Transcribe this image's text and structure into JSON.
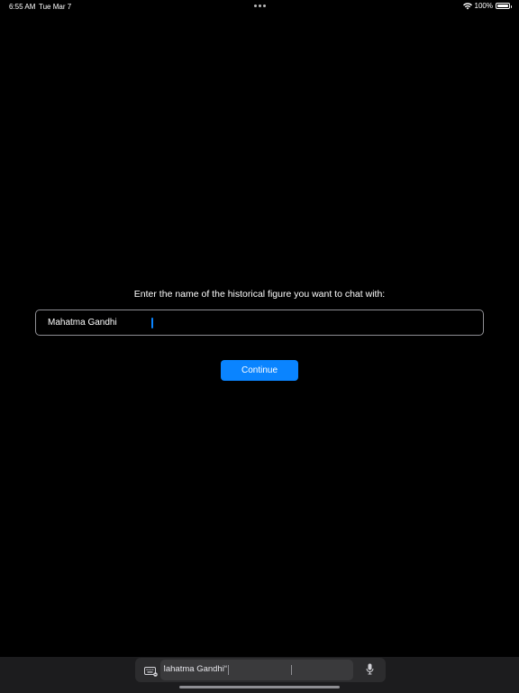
{
  "status_bar": {
    "time": "6:55 AM",
    "date": "Tue Mar 7",
    "battery_text": "100%",
    "battery_level": 1.0
  },
  "prompt": {
    "label": "Enter the name of the historical figure you want to chat with:"
  },
  "name_input": {
    "value": "Mahatma Gandhi"
  },
  "continue_button": {
    "label": "Continue"
  },
  "keyboard_bar": {
    "suggestion": "“Mahatma Gandhi”"
  },
  "icons": {
    "wifi": "wifi-icon",
    "battery": "battery-icon",
    "keyboard": "keyboard-icon",
    "microphone": "microphone-icon",
    "multitasking": "more-dots-icon"
  },
  "colors": {
    "background": "#000000",
    "accent": "#0a84ff",
    "input_border": "#8e8e93",
    "keyboard_bar": "#1c1c1e"
  }
}
